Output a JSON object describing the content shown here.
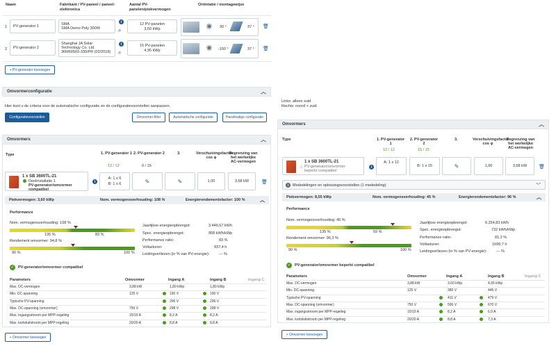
{
  "pv_table": {
    "headers": [
      "Naam",
      "Fabrikant / PV-paneel / paneel-elektronica",
      "Aantal PV-panelen/piekvermogen",
      "Oriëntatie / montagewijze"
    ],
    "rows": [
      {
        "num": "1",
        "name": "PV-generator 1",
        "manufacturer": "SMA",
        "panel": "SMA Demo Poly 300W",
        "count": "12 PV-panelen",
        "power": "3,60 kWp",
        "angle1": "30 °",
        "angle2": "37 °"
      },
      {
        "num": "2",
        "name": "PV-generator 2",
        "manufacturer": "Shanghai JA Solar Technology Co. Ltd.",
        "panel": "36M60503-330/PR (02/2018)",
        "count": "15 PV-panelen",
        "power": "4,95 kWp",
        "angle1": "-150 °",
        "angle2": "37 °"
      }
    ],
    "add_button": "+ PV-generator toevoegen"
  },
  "config": {
    "title": "Omvormerconfiguratie",
    "description": "Hier kunt u de criteria voor de automatische configuratie en de configuratievoorstellen aanpassen.",
    "btn_proposals": "Configuratievoorstellen",
    "btn_filter": "Omvormer-filter",
    "btn_auto": "Automatische configuratie",
    "btn_manual": "Handmatige configuratie",
    "note1": "Links: alleen zuid",
    "note2": "Rechts: noord + zuid"
  },
  "left": {
    "title": "Omvormers",
    "col_type": "Type",
    "col_g1": "1. PV-generator 1",
    "col_g2": "2. PV-generator 2",
    "col_3": "3.",
    "col_shift": "Verschuivingsfactor cos φ",
    "col_limit": "Begrenzing van het werkelijke AC-vermogen",
    "g1_count": "12 / 12",
    "g2_count": "0 / 15",
    "inv_name": "1 x SB 3600TL-21",
    "inv_sub": "Deelinstallatie 1",
    "inv_status": "PV-generator/omvormer compatibel",
    "config_a": "A: 1 x 6",
    "config_b": "B: 1 x 6",
    "cos": "1,00",
    "limit": "3,68 kW",
    "summary_peak": "Piekvermogen: 3,60 kWp",
    "summary_ratio": "Nom. vermogensverhouding: 108 %",
    "summary_energy": "Energierendementsfactor: 100 %",
    "perf_title": "Performance",
    "ratio_label": "Nom. vermogensverhouding: 108 %",
    "ratio_min": "135 %",
    "ratio_max": "83 %",
    "eff_label": "Rendement omvormer: 94,8 %",
    "eff_min": "90 %",
    "eff_max": "100 %",
    "stats": [
      {
        "label": "Jaarlijkse energieopbrengst:",
        "value": "3.446,67 kWh"
      },
      {
        "label": "Spec. energieopbrengst:",
        "value": "958 kWh/kWp"
      },
      {
        "label": "Performance ratio:",
        "value": "83 %"
      },
      {
        "label": "Vollasturen:",
        "value": "937,4 h"
      },
      {
        "label": "Leidingverliezen (in % van PV-energie):",
        "value": "--- %"
      }
    ],
    "compat_title": "PV-generator/omvormer compatibel",
    "param_headers": [
      "Parameters",
      "Omvormer",
      "Ingang A",
      "Ingang B",
      "Ingang C"
    ],
    "params": [
      {
        "label": "Max. DC-vermogen",
        "inv": "3,88 kW",
        "a": "1,80 kWp",
        "b": "1,80 kWp",
        "ca": false,
        "cb": false
      },
      {
        "label": "Min. DC-spanning",
        "inv": "125 V",
        "a": "190 V",
        "b": "190 V",
        "ca": true,
        "cb": true
      },
      {
        "label": "Typische PV-spanning",
        "inv": "",
        "a": "206 V",
        "b": "206 V",
        "ca": true,
        "cb": true
      },
      {
        "label": "Max. DC-spanning (omvormer)",
        "inv": "750 V",
        "a": "298 V",
        "b": "298 V",
        "ca": true,
        "cb": true
      },
      {
        "label": "Max. ingangsstroom per MPP-regeling",
        "inv": "15/15 A",
        "a": "8,2 A",
        "b": "8,2 A",
        "ca": true,
        "cb": true
      },
      {
        "label": "Max. kortsluitstroom per MPP-regeling",
        "inv": "20/20 A",
        "a": "8,8 A",
        "b": "8,8 A",
        "ca": true,
        "cb": true
      }
    ],
    "add_button": "+ Omvormer toevoegen"
  },
  "right": {
    "title": "Omvormers",
    "col_type": "Type",
    "col_g1": "1. PV-generator 1",
    "col_g2": "2. PV-generator 2",
    "col_3": "3.",
    "col_shift": "Verschuivingsfactor cos φ",
    "col_limit": "Begrenzing van het werkelijke AC-vermogen",
    "g1_count": "12 / 12",
    "g2_count": "15 / 15",
    "inv_name": "1 x SB 3600TL-21",
    "inv_sub": "PV-generator/omvormer",
    "inv_status": "beperkt compatibel",
    "config_a": "A: 1 x 12",
    "config_b": "B: 1 x 15",
    "cos": "1,00",
    "limit": "3,68 kW",
    "messages": "Mededelingen en oplossingsvoorstellen (1 mededeling)",
    "summary_peak": "Piekvermogen: 8,55 kWp",
    "summary_ratio": "Nom. vermogensverhouding: 45 %",
    "summary_energy": "Energierendementsfactor: 96 %",
    "perf_title": "Performance",
    "ratio_label": "Nom. vermogensverhouding: 45 %",
    "ratio_min": "135 %",
    "ratio_max": "59 %",
    "eff_label": "Rendement omvormer: 96,3 %",
    "eff_min": "90 %",
    "eff_max": "100 %",
    "stats": [
      {
        "label": "Jaarlijkse energieopbrengst:",
        "value": "6.254,83 kWh"
      },
      {
        "label": "Spec. energieopbrengst:",
        "value": "732 kWh/kWp"
      },
      {
        "label": "Performance ratio:",
        "value": "81,3 %"
      },
      {
        "label": "Vollasturen:",
        "value": "1699,7 h"
      },
      {
        "label": "Leidingverliezen (in % van PV-energie):",
        "value": "--- %"
      }
    ],
    "compat_title": "PV-generator/omvormer beperkt compatibel",
    "param_headers": [
      "Parameters",
      "Omvormer",
      "Ingang A",
      "Ingang B",
      "Ingang C"
    ],
    "params": [
      {
        "label": "Max. DC-vermogen",
        "inv": "3,88 kW",
        "a": "3,60 kWp",
        "b": "4,95 kWp",
        "ca": false,
        "cb": false
      },
      {
        "label": "Min. DC-spanning",
        "inv": "125 V",
        "a": "380 V",
        "b": "445 V",
        "ca": false,
        "cb": false
      },
      {
        "label": "Typische PV-spanning",
        "inv": "",
        "a": "411 V",
        "b": "479 V",
        "ca": true,
        "cb": true
      },
      {
        "label": "Max. DC-spanning (omvormer)",
        "inv": "750 V",
        "a": "596 V",
        "b": "670 V",
        "ca": true,
        "cb": true
      },
      {
        "label": "Max. ingangsstroom per MPP-regeling",
        "inv": "15/15 A",
        "a": "8,2 A",
        "b": "6,9 A",
        "ca": true,
        "cb": true
      },
      {
        "label": "Max. kortsluitstroom per MPP-regeling",
        "inv": "20/20 A",
        "a": "8,8 A",
        "b": "7,3 A",
        "ca": true,
        "cb": true
      }
    ],
    "add_button": "+ Omvormer toevoegen"
  },
  "colors": {
    "primary": "#1b5c99",
    "green": "#4a9b1f",
    "bar_yellow": "#e6d62a"
  }
}
